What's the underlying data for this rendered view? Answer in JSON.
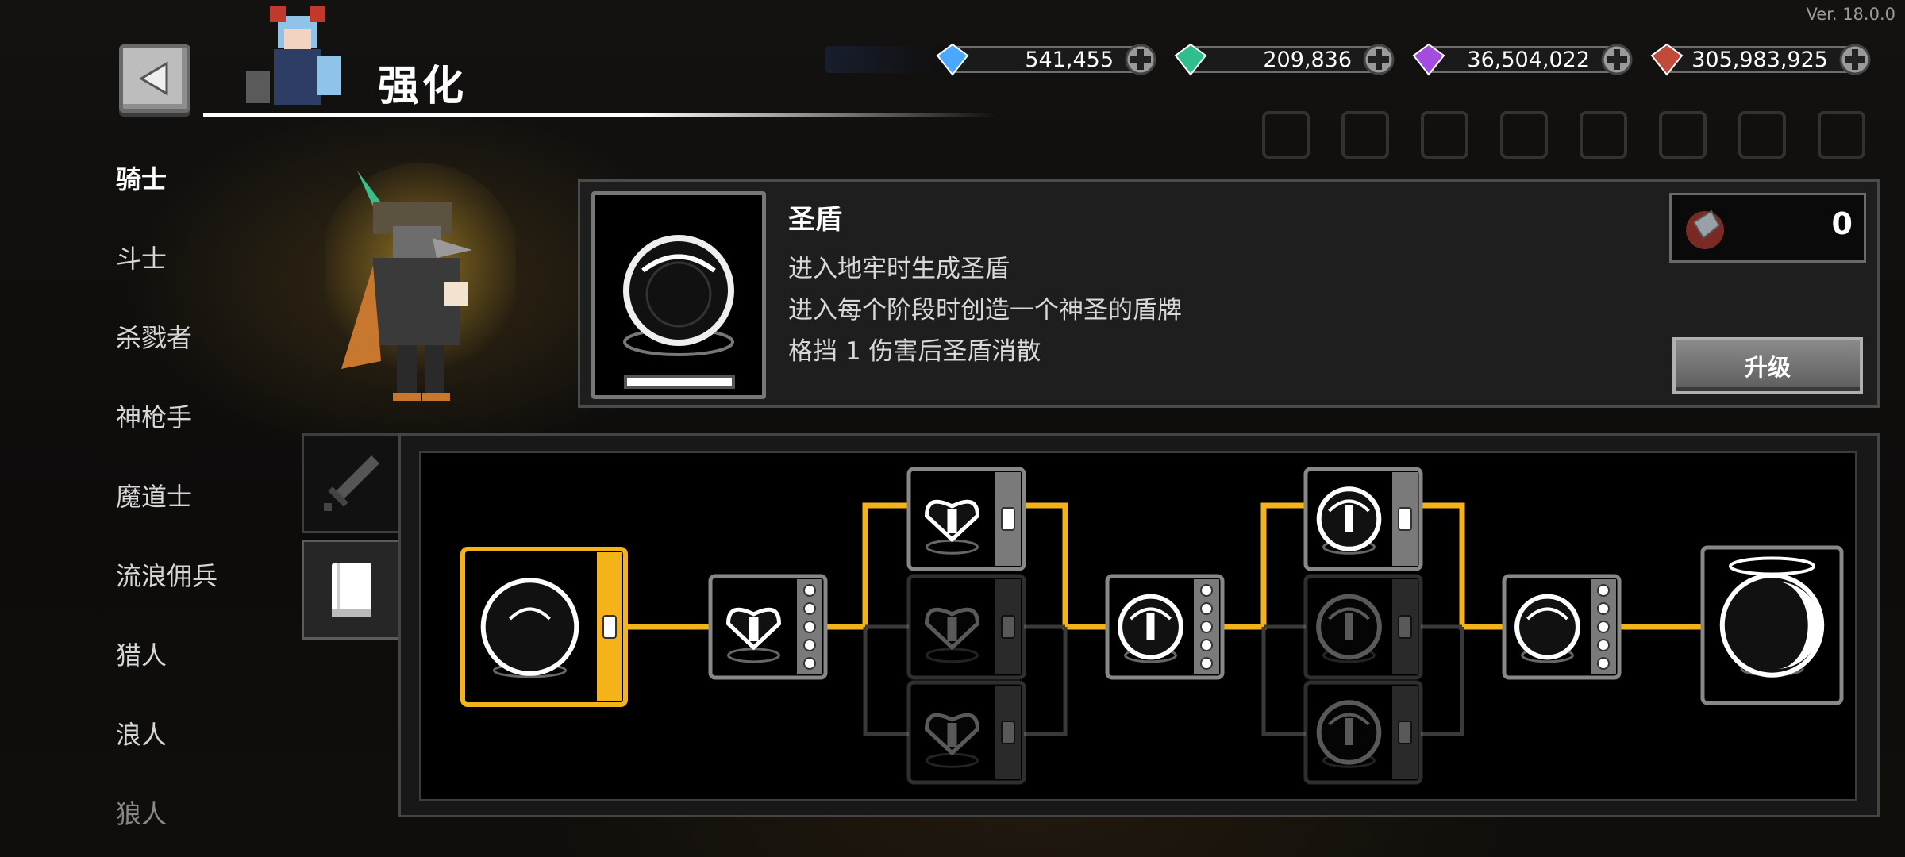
{
  "version": "Ver. 18.0.0",
  "header": {
    "title": "强化"
  },
  "currencies": [
    {
      "name": "diamond-icon",
      "value": "541,455",
      "color": "#4aa8ff"
    },
    {
      "name": "emerald-icon",
      "value": "209,836",
      "color": "#2fbf8f"
    },
    {
      "name": "crystal-icon",
      "value": "36,504,022",
      "color": "#a44be0"
    },
    {
      "name": "ore-icon",
      "value": "305,983,925",
      "color": "#c04b3a"
    }
  ],
  "classes": [
    "骑士",
    "斗士",
    "杀戮者",
    "神枪手",
    "魔道士",
    "流浪佣兵",
    "猎人",
    "浪人",
    "狼人"
  ],
  "active_class": "骑士",
  "skill": {
    "name": "圣盾",
    "desc": [
      "进入地牢时生成圣盾",
      "进入每个阶段时创造一个神圣的盾牌",
      "格挡 1 伤害后圣盾消散"
    ],
    "cost": "0",
    "upgrade_label": "升级"
  },
  "tabs": [
    {
      "name": "sword-icon",
      "active": false
    },
    {
      "name": "book-icon",
      "active": true
    }
  ],
  "colors": {
    "accent": "#f5b31a",
    "locked": "#3a3a3a"
  }
}
